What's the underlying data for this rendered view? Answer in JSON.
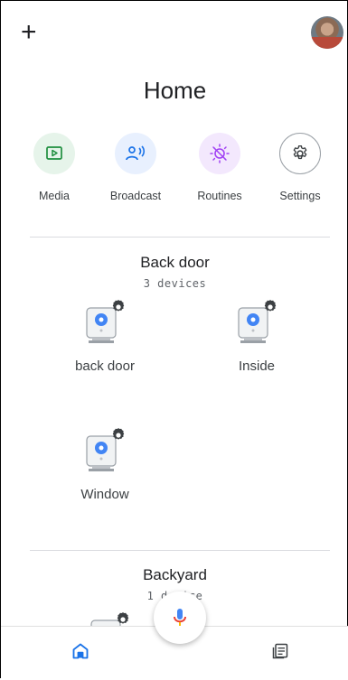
{
  "header": {
    "add_icon": "plus-icon",
    "avatar_icon": "profile-avatar",
    "plus_glyph": "+"
  },
  "title": "Home",
  "quick_actions": [
    {
      "label": "Media",
      "icon": "media-play-icon",
      "bg": "#e6f4ea",
      "fg": "#1e8e3e"
    },
    {
      "label": "Broadcast",
      "icon": "broadcast-person-icon",
      "bg": "#e8f0fe",
      "fg": "#1a73e8"
    },
    {
      "label": "Routines",
      "icon": "routines-sun-icon",
      "bg": "#f3e8fd",
      "fg": "#a142f4"
    },
    {
      "label": "Settings",
      "icon": "gear-icon",
      "bg": "#ffffff",
      "fg": "#5f6368"
    }
  ],
  "rooms": [
    {
      "name": "Back door",
      "count": "3 devices",
      "devices": [
        {
          "label": "back door"
        },
        {
          "label": "Inside"
        },
        {
          "label": "Window"
        }
      ]
    },
    {
      "name": "Backyard",
      "count": "1 device"
    }
  ],
  "bottom_nav": {
    "home_icon": "home-icon",
    "feed_icon": "feed-icon",
    "mic_icon": "mic-icon"
  },
  "colors": {
    "accent": "#1a73e8",
    "camera_dot": "#4285f4",
    "mic_red": "#ea4335",
    "mic_yellow": "#fbbc04"
  }
}
